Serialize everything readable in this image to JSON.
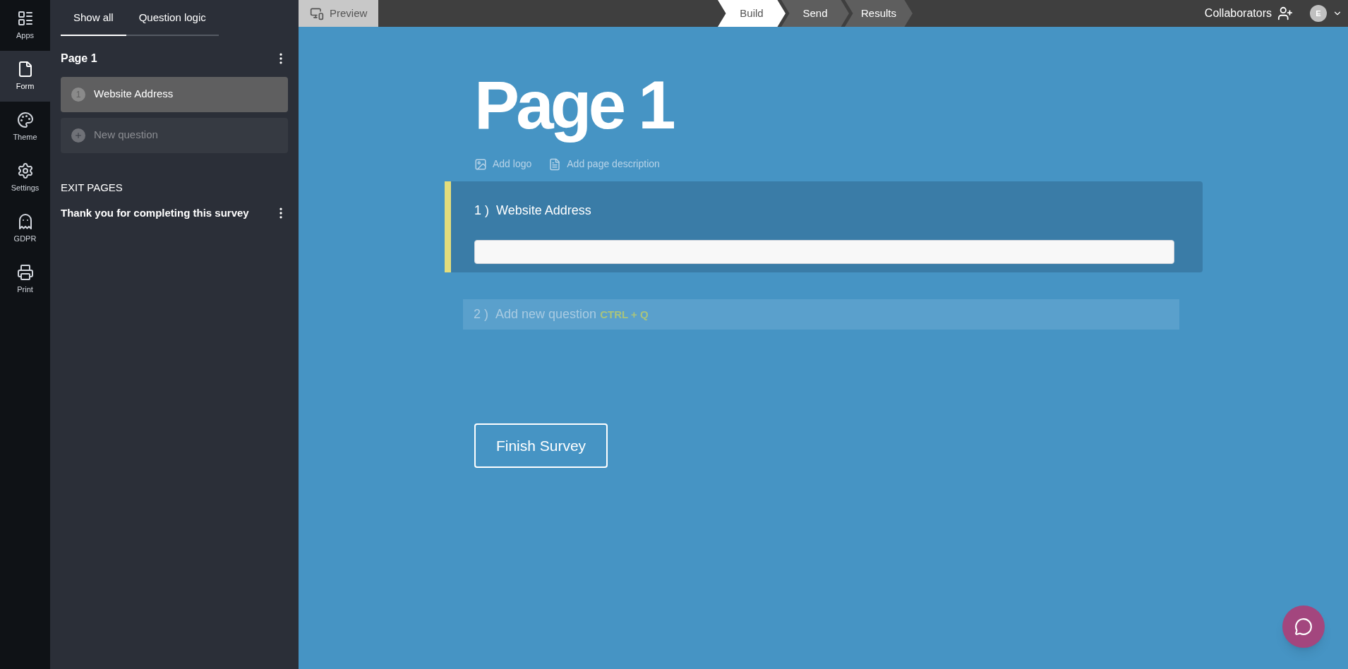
{
  "rail": [
    {
      "label": "Apps",
      "selected": false
    },
    {
      "label": "Form",
      "selected": true
    },
    {
      "label": "Theme",
      "selected": false
    },
    {
      "label": "Settings",
      "selected": false
    },
    {
      "label": "GDPR",
      "selected": false
    },
    {
      "label": "Print",
      "selected": false
    }
  ],
  "sidebar": {
    "tabs": [
      {
        "label": "Show all",
        "selected": true
      },
      {
        "label": "Question logic",
        "selected": false
      }
    ],
    "page_title": "Page 1",
    "items": [
      {
        "kind": "question",
        "number": "1",
        "label": "Website Address",
        "selected": true
      },
      {
        "kind": "new",
        "label": "New question",
        "selected": false
      }
    ],
    "exit_heading": "EXIT PAGES",
    "exit_pages": [
      "Thank you for completing this survey"
    ]
  },
  "topbar": {
    "preview": "Preview",
    "steps": [
      {
        "label": "Build",
        "selected": true
      },
      {
        "label": "Send",
        "selected": false
      },
      {
        "label": "Results",
        "selected": false
      }
    ],
    "collaborators": "Collaborators",
    "avatar": "E"
  },
  "main": {
    "title": "Page 1",
    "actions": [
      {
        "label": "Add logo"
      },
      {
        "label": "Add page description"
      }
    ],
    "question": {
      "number": "1 )",
      "label": "Website Address"
    },
    "new_question": {
      "number": "2 )",
      "label": "Add new question",
      "shortcut": "CTRL + Q"
    },
    "finish": "Finish Survey"
  }
}
